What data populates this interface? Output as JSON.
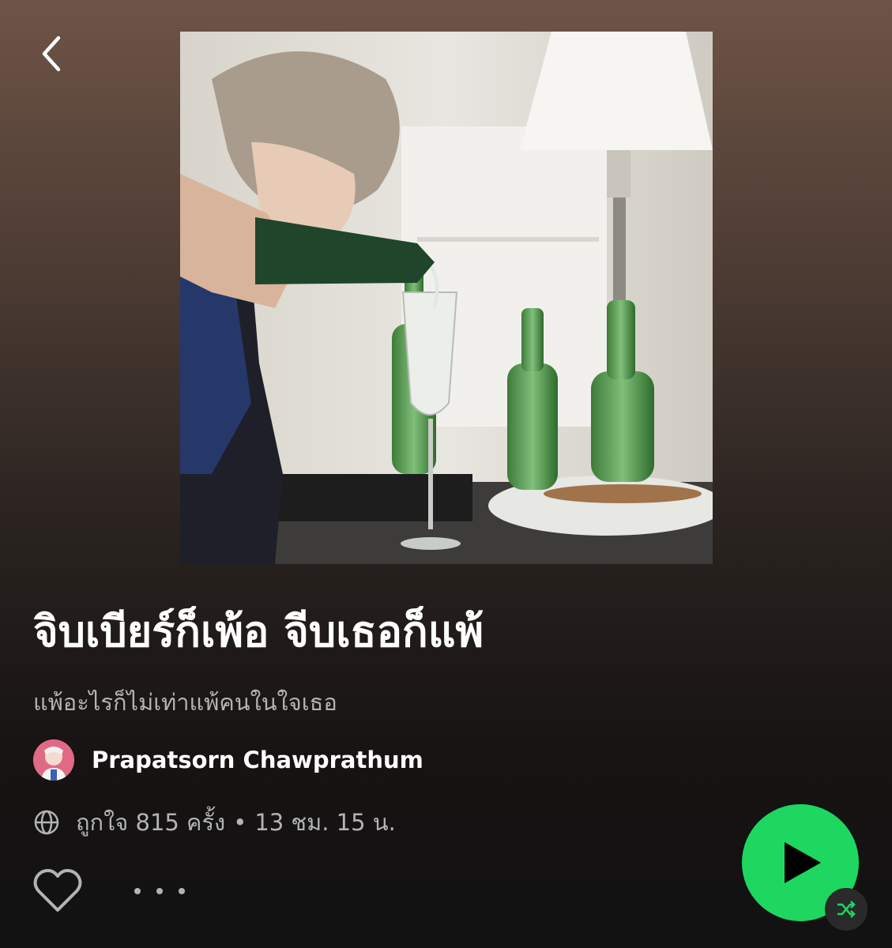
{
  "nav": {
    "back_icon": "chevron-left-icon"
  },
  "cover": {
    "description_icon": "playlist-cover-image"
  },
  "playlist": {
    "title": "จิบเบียร์ก็เพ้อ จีบเธอก็แพ้",
    "description": "แพ้อะไรก็ไม่เท่าแพ้คนในใจเธอ",
    "owner": "Prapatsorn Chawprathum",
    "likes": "ถูกใจ 815 ครั้ง",
    "separator": "•",
    "duration": "13 ชม. 15 น."
  },
  "actions": {
    "like_icon": "heart-outline-icon",
    "more_icon": "more-dots-icon",
    "play_icon": "play-icon",
    "shuffle_icon": "shuffle-icon"
  },
  "colors": {
    "accent": "#1ed760",
    "text_primary": "#ffffff",
    "text_secondary": "#b3b3b3",
    "background_top": "#6e5446",
    "background_bottom": "#121212"
  }
}
